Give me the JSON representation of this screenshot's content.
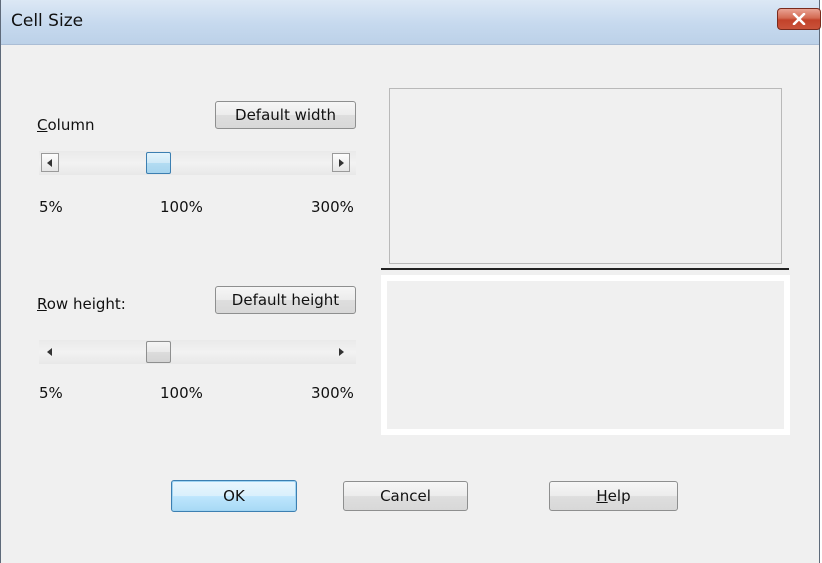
{
  "window": {
    "title": "Cell Size"
  },
  "column": {
    "label": "Column",
    "default_button": "Default width",
    "slider_value_percent": 100,
    "ticks": [
      "5%",
      "100%",
      "300%"
    ]
  },
  "row": {
    "label": "Row height:",
    "default_button": "Default height",
    "slider_value_percent": 100,
    "ticks": [
      "5%",
      "100%",
      "300%"
    ]
  },
  "footer": {
    "ok_label": "OK",
    "cancel_label": "Cancel",
    "help_label": "Help"
  },
  "colors": {
    "titlebar": "#c6d9ee",
    "close_button": "#c2422a",
    "default_button_border": "#3c7fb1",
    "dialog_background": "#f0f0f0"
  },
  "icons": {
    "close": "close-x-icon",
    "slider_left": "arrow-left-icon",
    "slider_right": "arrow-right-icon"
  }
}
